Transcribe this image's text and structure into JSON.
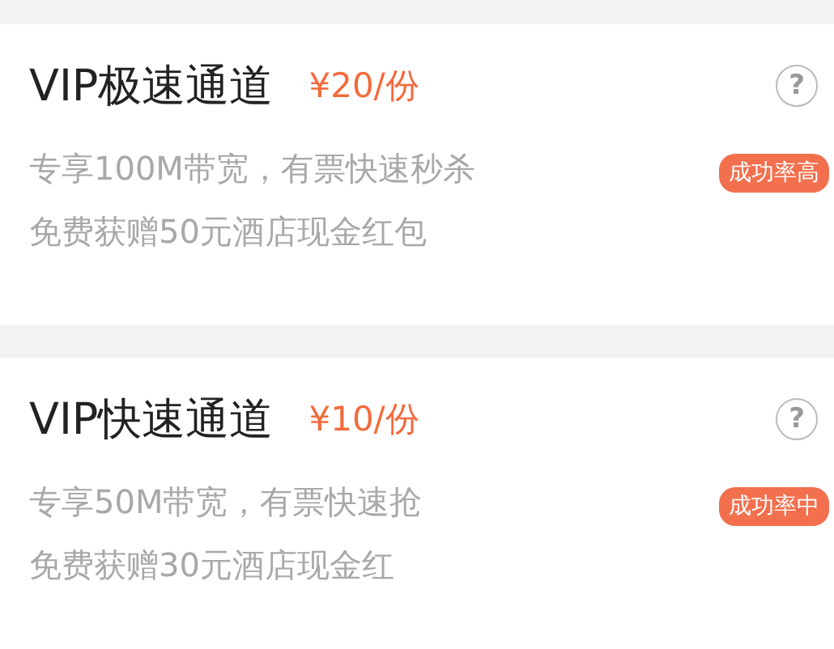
{
  "channels": [
    {
      "title": "VIP极速通道",
      "price": "¥20/份",
      "help": "?",
      "lines": [
        "专享100M带宽，有票快速秒杀",
        "免费获赠50元酒店现金红包"
      ],
      "badge": "成功率高"
    },
    {
      "title": "VIP快速通道",
      "price": "¥10/份",
      "help": "?",
      "lines": [
        "专享50M带宽，有票快速抢",
        "免费获赠30元酒店现金红"
      ],
      "badge": "成功率中"
    }
  ]
}
